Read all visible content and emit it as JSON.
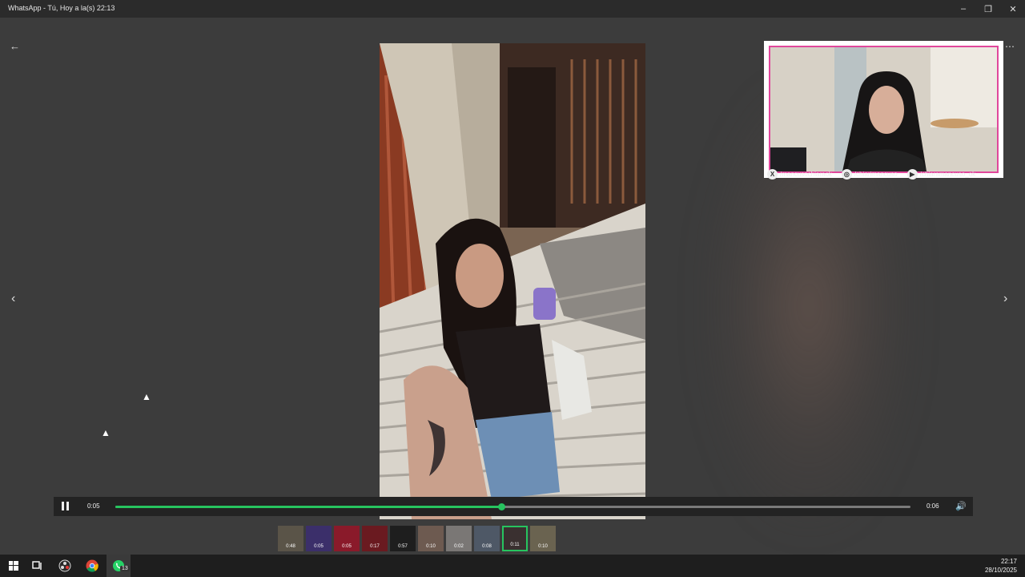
{
  "window": {
    "title": "WhatsApp - Tú, Hoy a la(s) 22:13",
    "minimize_glyph": "–",
    "restore_glyph": "❐",
    "close_glyph": "✕"
  },
  "viewer": {
    "back_icon": "←",
    "prev_icon": "‹",
    "next_icon": "›",
    "more_icon": "⋯"
  },
  "overlay": {
    "socials": [
      {
        "icon": "X",
        "handle": "/mancusochiaraok"
      },
      {
        "icon": "◎",
        "handle": "/chiarimancuso"
      },
      {
        "icon": "▶",
        "handle": "/chiaramancuso_ok"
      }
    ]
  },
  "player": {
    "current_time": "0:05",
    "duration": "0:06",
    "progress": 0.485,
    "volume_icon": "🔊"
  },
  "thumbnails": [
    {
      "label": "0:48",
      "color": "#5a5448"
    },
    {
      "label": "0:05",
      "color": "#3b2f6a"
    },
    {
      "label": "0:05",
      "color": "#8a1a2a"
    },
    {
      "label": "0:17",
      "color": "#6a1a20"
    },
    {
      "label": "0:57",
      "color": "#1e1e1e"
    },
    {
      "label": "0:10",
      "color": "#6d5a50"
    },
    {
      "label": "0:02",
      "color": "#7a7775"
    },
    {
      "label": "0:08",
      "color": "#4e5866"
    },
    {
      "label": "0:11",
      "color": "#3a3030",
      "selected": true
    },
    {
      "label": "0:10",
      "color": "#6a6350"
    }
  ],
  "taskbar": {
    "time": "22:17",
    "date": "28/10/2025",
    "whatsapp_badge": "13"
  },
  "colors": {
    "accent": "#27c45f",
    "stream_frame": "#e0479b"
  }
}
